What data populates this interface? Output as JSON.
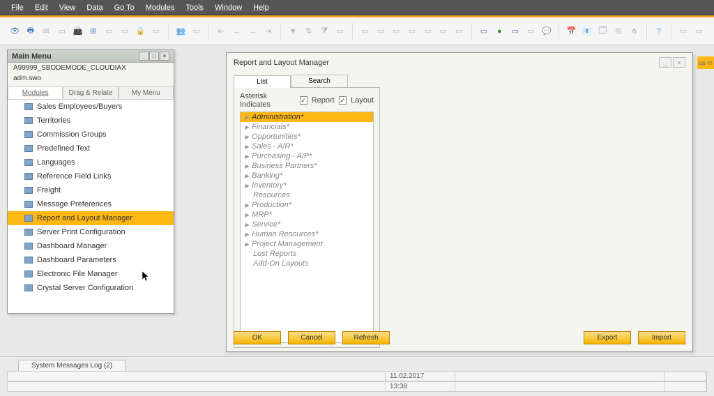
{
  "menubar": [
    "File",
    "Edit",
    "View",
    "Data",
    "Go To",
    "Modules",
    "Tools",
    "Window",
    "Help"
  ],
  "mainmenu": {
    "title": "Main Menu",
    "subtitle1": "A99999_SBODEMODE_CLOUDIAX",
    "subtitle2": "adm.swo",
    "tabs": [
      "Modules",
      "Drag & Relate",
      "My Menu"
    ],
    "items": [
      "Sales Employees/Buyers",
      "Territories",
      "Commission Groups",
      "Predefined Text",
      "Languages",
      "Reference Field Links",
      "Freight",
      "Message Preferences",
      "Report and Layout Manager",
      "Server Print Configuration",
      "Dashboard Manager",
      "Dashboard Parameters",
      "Electronic File Manager",
      "Crystal Server Configuration"
    ],
    "selected": "Report and Layout Manager"
  },
  "rlm": {
    "title": "Report and Layout Manager",
    "tabs": [
      "List",
      "Search"
    ],
    "asterisk_label": "Asterisk Indicates",
    "chk_report": "Report",
    "chk_layout": "Layout",
    "tree": [
      {
        "label": "Administration*",
        "selected": true,
        "expand": true
      },
      {
        "label": "Financials*",
        "expand": true
      },
      {
        "label": "Opportunities*",
        "expand": true
      },
      {
        "label": "Sales - A/R*",
        "expand": true
      },
      {
        "label": "Purchasing - A/P*",
        "expand": true
      },
      {
        "label": "Business Partners*",
        "expand": true
      },
      {
        "label": "Banking*",
        "expand": true
      },
      {
        "label": "Inventory*",
        "expand": true
      },
      {
        "label": "Resources",
        "leaf": true
      },
      {
        "label": "Production*",
        "expand": true
      },
      {
        "label": "MRP*",
        "expand": true
      },
      {
        "label": "Service*",
        "expand": true
      },
      {
        "label": "Human Resources*",
        "expand": true
      },
      {
        "label": "Project Management",
        "expand": true
      },
      {
        "label": "Lost Reports",
        "leaf": true
      },
      {
        "label": "Add-On Layouts",
        "leaf": true
      }
    ],
    "buttons": {
      "ok": "OK",
      "cancel": "Cancel",
      "refresh": "Refresh",
      "export": "Export",
      "import": "Import"
    }
  },
  "yellowtag": "up m",
  "syslog": "System Messages Log (2)",
  "status": {
    "date": "11.02.2017",
    "time": "13:38"
  }
}
